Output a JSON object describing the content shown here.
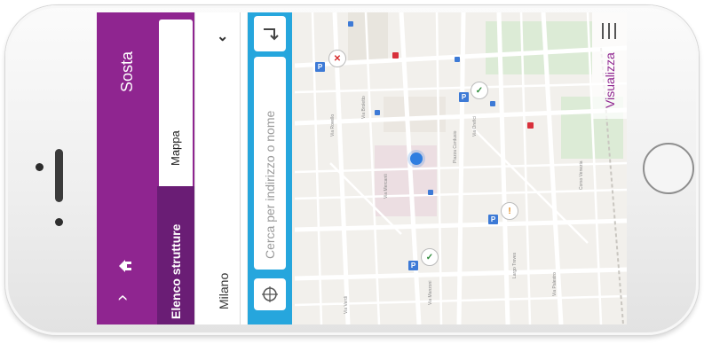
{
  "header": {
    "title": "Sosta"
  },
  "tabs": {
    "elenco_label": "Elenco strutture",
    "mappa_label": "Mappa"
  },
  "city": {
    "value": "Milano",
    "chevron": "›"
  },
  "search": {
    "placeholder": "Cerca per indirizzo o nome"
  },
  "map": {
    "visualizza_label": "Visualizza"
  },
  "icons": {
    "back": "chevron-left-icon",
    "home": "home-icon",
    "locate": "crosshair-icon",
    "go": "return-arrow-icon",
    "menu": "hamburger-menu-icon",
    "parking": "parking-icon",
    "available": "check-icon",
    "full": "cross-icon"
  },
  "colors": {
    "purple": "#8f2590",
    "purple_dark": "#6a1d75",
    "blue_panel": "#26a6dd",
    "map_bg": "#f2f0ec",
    "ok": "#2e8b3a",
    "full": "#d62b2b",
    "warn": "#e08a1e"
  }
}
